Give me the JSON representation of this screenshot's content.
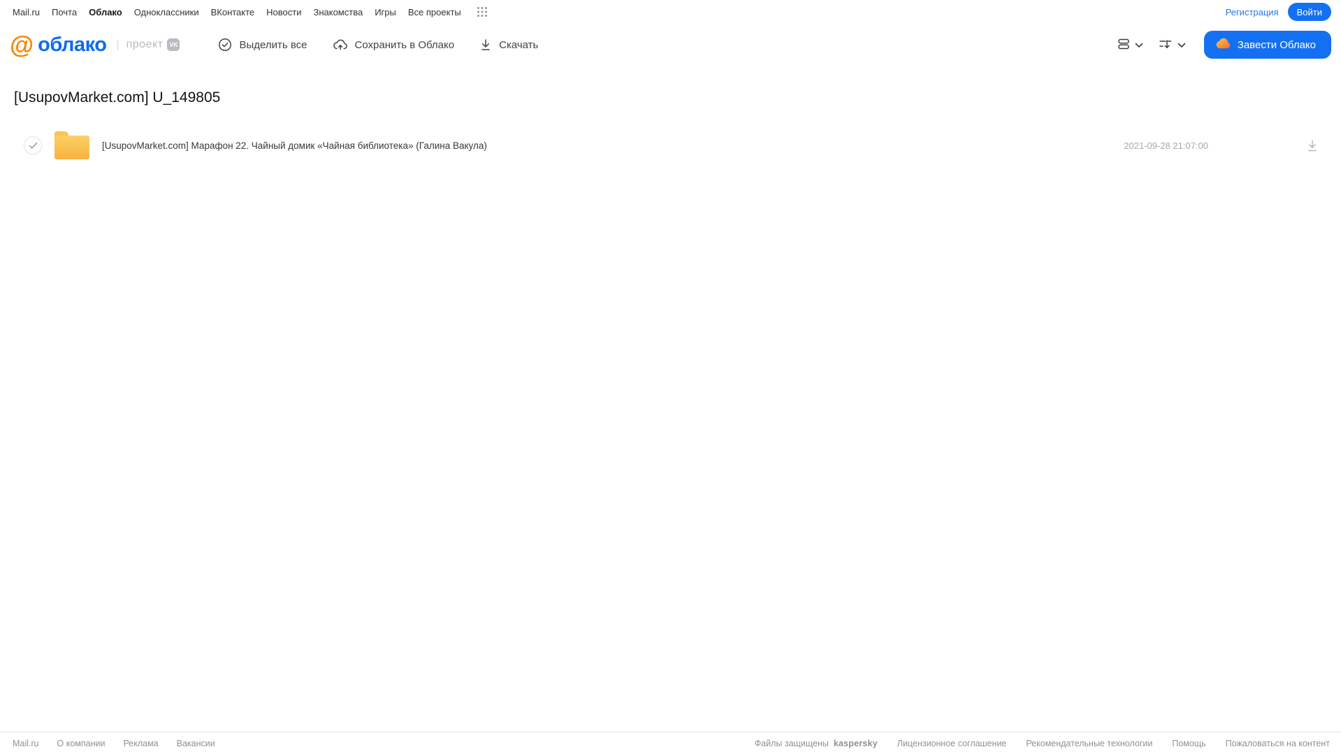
{
  "topbar": {
    "links": [
      "Mail.ru",
      "Почта",
      "Облако",
      "Одноклассники",
      "ВКонтакте",
      "Новости",
      "Знакомства",
      "Игры",
      "Все проекты"
    ],
    "active_link": "Облако",
    "registration_label": "Регистрация",
    "login_label": "Войти"
  },
  "header": {
    "logo_text": "облако",
    "logo_separator": "|",
    "project_label": "проект",
    "vk_badge": "VK",
    "toolbar": {
      "select_all_label": "Выделить все",
      "save_to_cloud_label": "Сохранить в Облако",
      "download_label": "Скачать"
    },
    "get_cloud_label": "Завести Облако"
  },
  "main": {
    "title": "[UsupovMarket.com] U_149805",
    "files": [
      {
        "name": "[UsupovMarket.com] Марафон 22. Чайный домик «Чайная библиотека» (Галина Вакула)",
        "date": "2021-09-28 21:07:00",
        "type": "folder",
        "selected": false
      }
    ]
  },
  "footer": {
    "left_links": [
      "Mail.ru",
      "О компании",
      "Реклама",
      "Вакансии"
    ],
    "protected_text": "Файлы защищены",
    "kaspersky_label": "kaspersky",
    "right_links": [
      "Лицензионное соглашение",
      "Рекомендательные технологии",
      "Помощь",
      "Пожаловаться на контент"
    ]
  },
  "colors": {
    "accent_blue": "#1470f3",
    "logo_orange": "#f88600",
    "logo_blue": "#0d6bf2",
    "folder_yellow": "#f9c254",
    "kaspersky_green": "#00735c",
    "cloud_icon_orange": "#f5813a"
  }
}
